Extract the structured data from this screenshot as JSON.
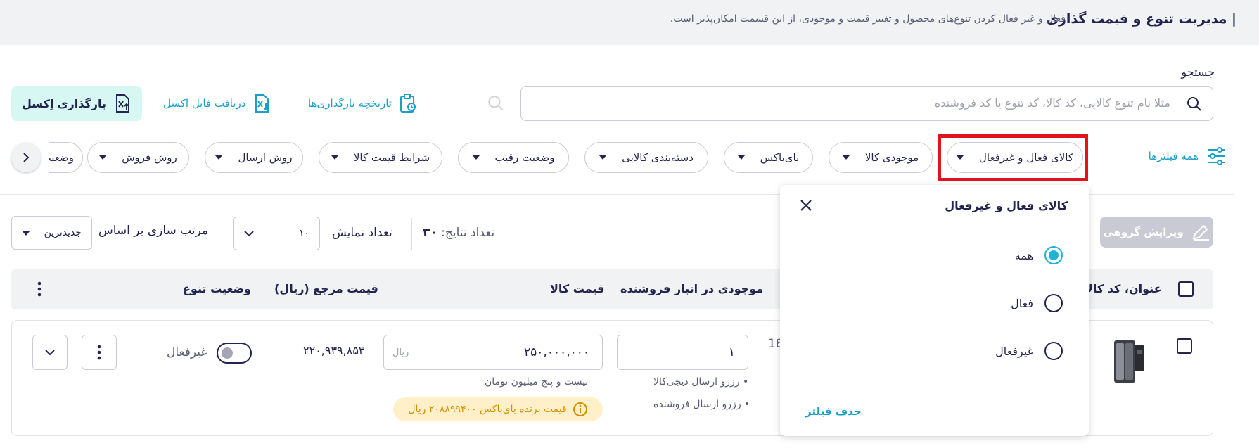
{
  "header": {
    "title": "مدیریت تنوع و قیمت گذاری",
    "description": "فعال و غیر فعال کردن تنوع‌های محصول و تغییر قیمت و موجودی، از این قسمت امکان‌پذیر است."
  },
  "search": {
    "label": "جستجو",
    "placeholder": "مثلا نام تنوع کالایی، کد کالا، کد تنوع یا کد فروشنده"
  },
  "actions": {
    "upload_history": "تاریخچه بارگذاری‌ها",
    "download_excel": "دریافت فایل اِکسل",
    "upload_excel": "بارگذاری اِکسل"
  },
  "filters": {
    "all_filters": "همه فیلترها",
    "chips": [
      "کالای فعال و غیرفعال",
      "موجودی کالا",
      "بای‌باکس",
      "دسته‌بندی کالایی",
      "وضعیت رقیب",
      "شرایط قیمت کالا",
      "روش ارسال",
      "روش فروش"
    ],
    "partial_chip": "وضعیت"
  },
  "toolbar": {
    "bulk_edit": "ویرایش گروهی",
    "results_label": "تعداد نتایج:",
    "results_count": "۳۰",
    "display_count_label": "تعداد نمایش",
    "display_count_value": "۱۰",
    "sort_label": "مرتب سازی بر اساس",
    "sort_value": "جدیدترین"
  },
  "table": {
    "columns": {
      "title": "عنوان، کد کالا",
      "stock": "موجودی در انبار فروشنده",
      "price": "قیمت کالا",
      "ref_price": "قیمت مرجع (ریال)",
      "status": "وضعیت تنوع"
    },
    "row": {
      "partial_number": "18",
      "stock_value": "۱",
      "reserve_digikala": "• رزرو ارسال دیجی‌کالا",
      "reserve_seller": "• رزرو ارسال فروشنده",
      "price_value": "۲۵۰,۰۰۰,۰۰۰",
      "price_unit": "ریال",
      "price_words": "بیست و پنج میلیون تومان",
      "winner_badge": "قیمت برنده بای‌باکس ۲۰۸۸۹۹۴۰۰ ریال",
      "ref_price": "۲۲۰,۹۳۹,۸۵۳",
      "status_label": "غیرفعال"
    }
  },
  "popup": {
    "title": "کالای فعال و غیرفعال",
    "options": [
      "همه",
      "فعال",
      "غیرفعال"
    ],
    "selected": 0,
    "remove_filter": "حذف فیلتر"
  },
  "colors": {
    "accent": "#1fb4d6",
    "link": "#1a9fc9",
    "highlight": "#e1131c",
    "warning": "#d68e00"
  }
}
